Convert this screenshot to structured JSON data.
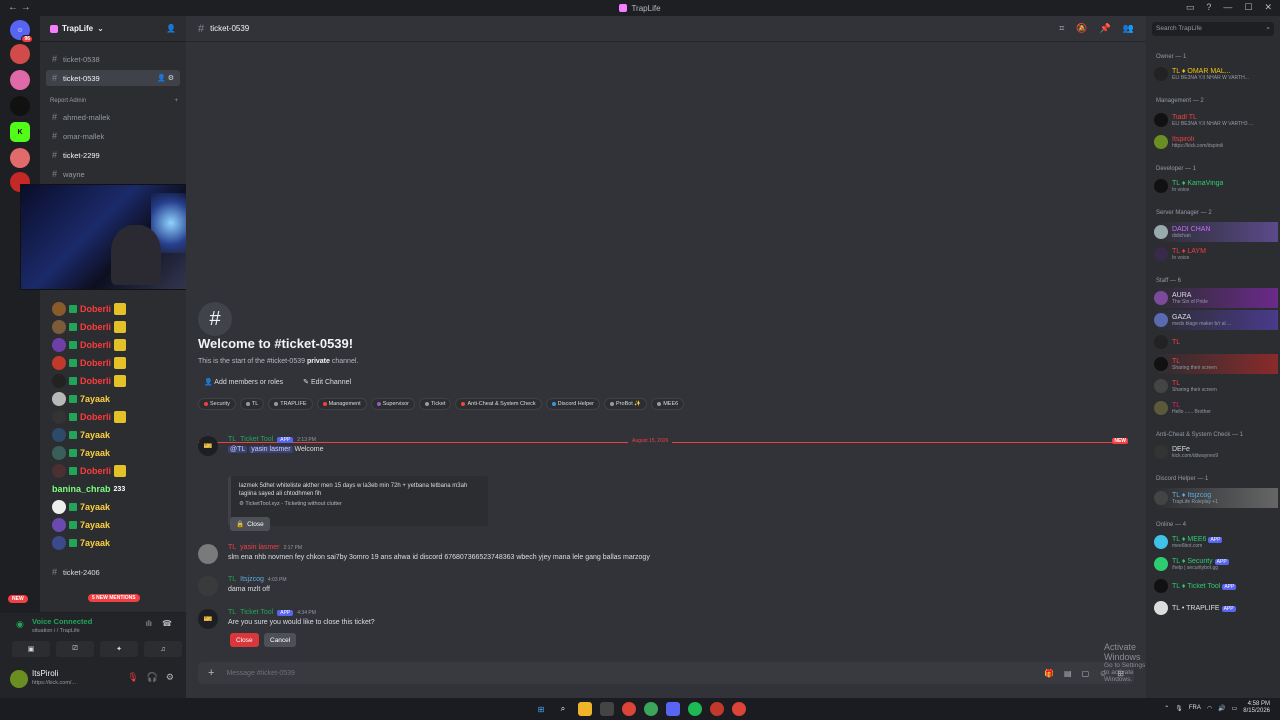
{
  "window": {
    "title": "TrapLife"
  },
  "server": {
    "name": "TrapLife"
  },
  "channels": {
    "items": [
      {
        "label": "ticket-0538"
      },
      {
        "label": "ticket-0539"
      },
      {
        "label": "ahmed-mallek"
      },
      {
        "label": "omar-mallek"
      },
      {
        "label": "ticket-2299"
      },
      {
        "label": "wayne"
      },
      {
        "label": "ticket-2406"
      }
    ],
    "category": "Report Admin"
  },
  "voice_users": [
    {
      "name": "Doberli"
    },
    {
      "name": "Doberli"
    },
    {
      "name": "Doberli"
    },
    {
      "name": "Doberli"
    },
    {
      "name": "Doberli"
    },
    {
      "name": "7ayaak"
    },
    {
      "name": "Doberli"
    },
    {
      "name": "7ayaak"
    },
    {
      "name": "7ayaak"
    },
    {
      "name": "Doberli"
    },
    {
      "name": "banina_chrab"
    },
    {
      "name": "7ayaak"
    },
    {
      "name": "7ayaak"
    },
    {
      "name": "7ayaak"
    }
  ],
  "badges": {
    "new": "NEW",
    "mentions": "5 NEW MENTIONS",
    "date": "August 15, 2026",
    "newtag": "NEW"
  },
  "voice_panel": {
    "title": "Voice Connected",
    "subtitle": "situation i / TrapLife"
  },
  "user_panel": {
    "name": "ItsPiroli",
    "status": "https://kick.com/..."
  },
  "channel_header": {
    "name": "ticket-0539"
  },
  "welcome": {
    "title": "Welcome to #ticket-0539!",
    "sub_pre": "This is the start of the #ticket-0539 ",
    "sub_bold": "private",
    "sub_post": " channel.",
    "add_members": "Add members or roles",
    "edit_channel": "Edit Channel"
  },
  "roles": [
    "Security",
    "TL",
    "TRAPLIFE",
    "Management",
    "Supervisor",
    "Ticket",
    "Anti-Cheat & System Check",
    "Discord Helper",
    "ProBot ✨",
    "MEE6"
  ],
  "messages": [
    {
      "tag": "TL",
      "author": "Ticket Tool",
      "app": "APP",
      "time": "2:13 PM",
      "mention": "@TL",
      "mention_name": "yasin lasmer",
      "text": "Welcome"
    },
    {
      "tag": "TL",
      "author": "yasin lasmer",
      "time": "2:17 PM",
      "text": "slm ena nhb novmen fey chkon sai7by 3omro 19 ans  ahwa id discord 676807366523748363  wbech yjey mana lele gang ballas marzogy"
    },
    {
      "tag": "TL",
      "author": "Itsjzcog",
      "time": "4:03 PM",
      "text": "dama  mzlt off"
    },
    {
      "tag": "TL",
      "author": "Ticket Tool",
      "app": "APP",
      "time": "4:34 PM",
      "text": "Are you sure you would like to close this ticket?"
    }
  ],
  "embed": {
    "line1": "lazmek 5dhet whiteliste akther men 15 days w la3eb min 72h + yetbana tetbana m3ah",
    "line2": "tagiina sayed ali chtodhmen fih",
    "footer": "TicketTool.xyz - Ticketing without clutter"
  },
  "buttons": {
    "close": "Close",
    "confirm_close": "Close",
    "cancel": "Cancel"
  },
  "composer": {
    "placeholder": "Message #ticket-0539"
  },
  "activate": {
    "title": "Activate Windows",
    "sub": "Go to Settings to activate Windows."
  },
  "members_search": {
    "placeholder": "Search TrapLife"
  },
  "member_groups": [
    {
      "label": "Owner — 1"
    },
    {
      "label": "Management — 2"
    },
    {
      "label": "Developer — 1"
    },
    {
      "label": "Server Manager — 2"
    },
    {
      "label": "Staff — 6"
    },
    {
      "label": "Anti-Cheat & System Check — 1"
    },
    {
      "label": "Discord Helper — 1"
    },
    {
      "label": "Online — 4"
    }
  ],
  "members": [
    {
      "name": "TL ♦ OMAR MAL...",
      "status": "ELI BE3NA Y.II NHAR W VARTH..."
    },
    {
      "name": "Tiadl TL",
      "status": "ELI BE3NA Y.II NHAR W VARTH3 ..."
    },
    {
      "name": "Itspiroli",
      "status": "https://kick.com/itspiroli"
    },
    {
      "name": "TL ♦ KamaVinga",
      "status": "In voice"
    },
    {
      "name": "DADI CHAN",
      "status": "didichan"
    },
    {
      "name": "TL ♦ LAYM",
      "status": "In voice"
    },
    {
      "name": "AURA",
      "status": "The Sin of Pride"
    },
    {
      "name": "GAZA",
      "status": "meds blage maker b/r al ..."
    },
    {
      "name": "TL",
      "status": ""
    },
    {
      "name": "TL",
      "status": "Sharing their screen"
    },
    {
      "name": "TL",
      "status": "Sharing their screen"
    },
    {
      "name": "TL",
      "status": "Hello ...... Brother"
    },
    {
      "name": "DEFe",
      "status": "kick.com/ddwaynex9"
    },
    {
      "name": "TL ♦ Itsjzcog",
      "status": "TrapLife Roleplay +1"
    },
    {
      "name": "TL ♦ MEE6",
      "status": "mee6bot.com",
      "app": "APP"
    },
    {
      "name": "TL ♦ Security",
      "status": "/help | securitybot.gg",
      "app": "APP"
    },
    {
      "name": "TL ♦ Ticket Tool",
      "status": "",
      "app": "APP"
    },
    {
      "name": "TL • TRAPLIFE",
      "status": "",
      "app": "APP"
    }
  ],
  "tray": {
    "lang": "FRA",
    "time": "4:58 PM",
    "date": "8/15/2026"
  }
}
